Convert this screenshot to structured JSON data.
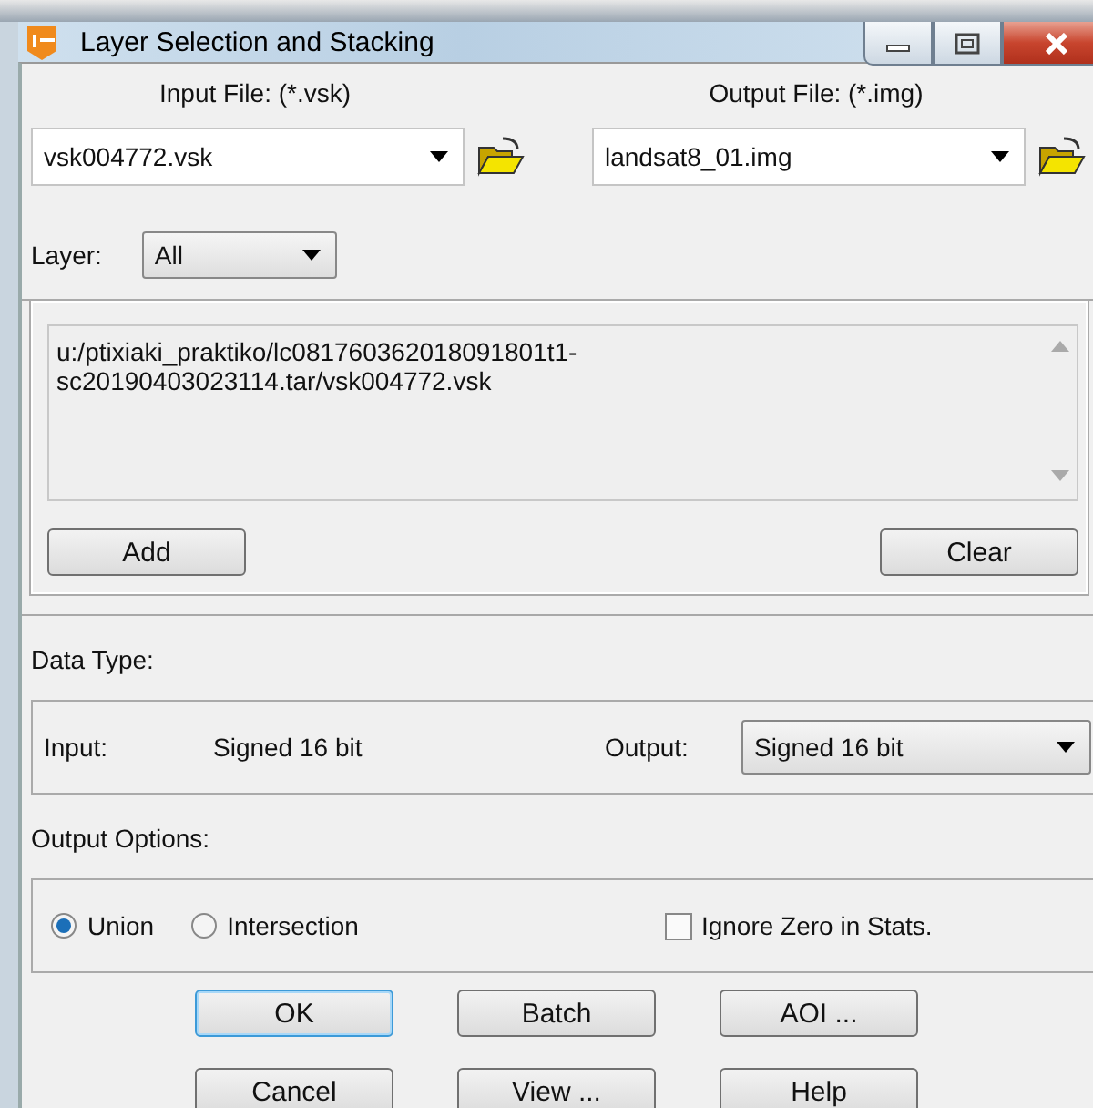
{
  "window": {
    "title": "Layer Selection and Stacking"
  },
  "input_file": {
    "label": "Input File: (*.vsk)",
    "value": "vsk004772.vsk"
  },
  "output_file": {
    "label": "Output File: (*.img)",
    "value": "landsat8_01.img"
  },
  "layer": {
    "label": "Layer:",
    "value": "All"
  },
  "layer_list": {
    "lines": [
      "u:/ptixiaki_praktiko/lc081760362018091801t1-",
      "sc20190403023114.tar/vsk004772.vsk"
    ]
  },
  "list_buttons": [
    "Add",
    "Clear"
  ],
  "data_type": {
    "heading": "Data Type:",
    "input_label": "Input:",
    "input_value": "Signed 16 bit",
    "output_label": "Output:",
    "output_value": "Signed 16 bit"
  },
  "output_options": {
    "heading": "Output Options:",
    "radios": [
      {
        "label": "Union",
        "selected": true
      },
      {
        "label": "Intersection",
        "selected": false
      }
    ],
    "ignore_zero": {
      "label": "Ignore Zero in Stats.",
      "checked": false
    }
  },
  "buttons": [
    {
      "label": "OK",
      "focused": true
    },
    {
      "label": "Batch",
      "focused": false
    },
    {
      "label": "AOI ...",
      "focused": false
    },
    {
      "label": "Cancel",
      "focused": false
    },
    {
      "label": "View ...",
      "focused": false
    },
    {
      "label": "Help",
      "focused": false
    }
  ]
}
